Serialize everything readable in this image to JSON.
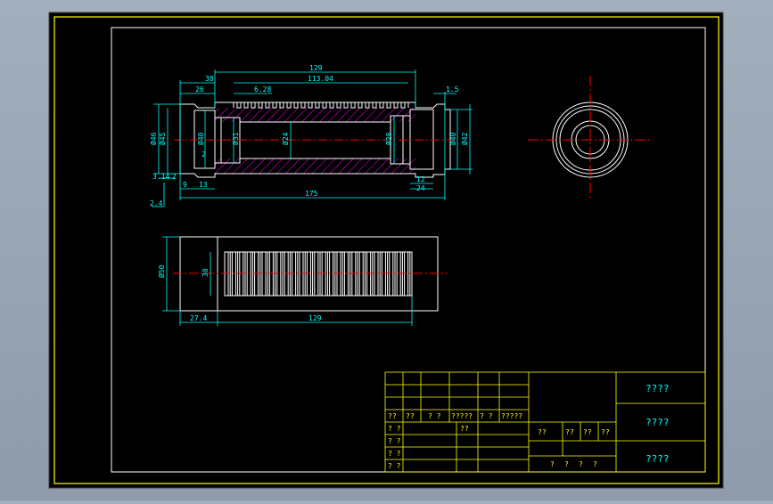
{
  "colors": {
    "sheet": "#000000",
    "frame": "#ffff00",
    "outline": "#ffffff",
    "dimension": "#00ffff",
    "centerline": "#ff0000",
    "hatch": "#ff00ff",
    "background": "#9aa6b4"
  },
  "dimensions": {
    "top": {
      "d129": "129",
      "d113": "113.04",
      "d38": "38",
      "d26": "26",
      "d628": "6.28",
      "d15": "1.5",
      "d175": "175",
      "d12": "12",
      "d24": "24",
      "d9": "9",
      "d13": "13",
      "d314": "3.14",
      "d2": "2",
      "d24s": "2.4",
      "d2b": "2",
      "phi46": "Ø46",
      "phi45": "Ø45",
      "phi40": "Ø40",
      "phi31": "Ø31",
      "phi24": "Ø24",
      "phi28": "Ø28",
      "phi40r": "Ø40",
      "phi42": "Ø42"
    },
    "bottom": {
      "phi50": "Ø50",
      "d30": "30",
      "d274": "27.4",
      "d129": "129"
    }
  },
  "title_block": {
    "left_row_labels": [
      "??",
      "??",
      "? ?",
      "?????",
      "? ?",
      "?????"
    ],
    "left_row_labels_2": [
      "? ?",
      "??"
    ],
    "left_col_labels": [
      "? ?",
      "? ?",
      "? ?",
      "? ?"
    ],
    "mid_labels": [
      "??",
      "??",
      "??",
      "??"
    ],
    "mid_bottom": [
      "?",
      "?",
      "?",
      "?"
    ],
    "right_cells": [
      "????",
      "????",
      "????"
    ]
  }
}
